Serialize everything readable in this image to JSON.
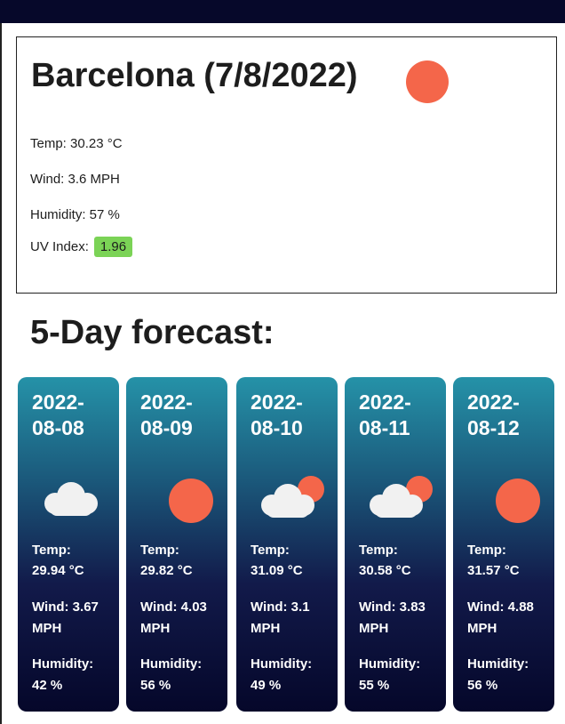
{
  "current": {
    "title": "Barcelona (7/8/2022)",
    "icon": "sun-icon",
    "temp": "Temp: 30.23 °C",
    "wind": "Wind: 3.6 MPH",
    "humidity": "Humidity: 57 %",
    "uv_label": "UV Index:",
    "uv_value": "1.96",
    "uv_color": "#7bd356"
  },
  "forecast": {
    "heading": "5-Day forecast:",
    "days": [
      {
        "date": "2022-08-08",
        "icon": "cloud-icon",
        "temp_label": "Temp:",
        "temp": "29.94 °C",
        "wind": "Wind: 3.67 MPH",
        "humidity_label": "Humidity:",
        "humidity": "42 %"
      },
      {
        "date": "2022-08-09",
        "icon": "sun-icon",
        "temp_label": "Temp:",
        "temp": "29.82 °C",
        "wind": "Wind: 4.03 MPH",
        "humidity_label": "Humidity:",
        "humidity": "56 %"
      },
      {
        "date": "2022-08-10",
        "icon": "partly-cloudy-icon",
        "temp_label": "Temp:",
        "temp": "31.09 °C",
        "wind": "Wind: 3.1 MPH",
        "humidity_label": "Humidity:",
        "humidity": "49 %"
      },
      {
        "date": "2022-08-11",
        "icon": "partly-cloudy-icon",
        "temp_label": "Temp:",
        "temp": "30.58 °C",
        "wind": "Wind: 3.83 MPH",
        "humidity_label": "Humidity:",
        "humidity": "55 %"
      },
      {
        "date": "2022-08-12",
        "icon": "sun-icon",
        "temp_label": "Temp:",
        "temp": "31.57 °C",
        "wind": "Wind: 4.88 MPH",
        "humidity_label": "Humidity:",
        "humidity": "56 %"
      }
    ]
  },
  "colors": {
    "sun": "#f4664a",
    "cloud": "#f1f1f1",
    "top_bar": "#06082a"
  }
}
